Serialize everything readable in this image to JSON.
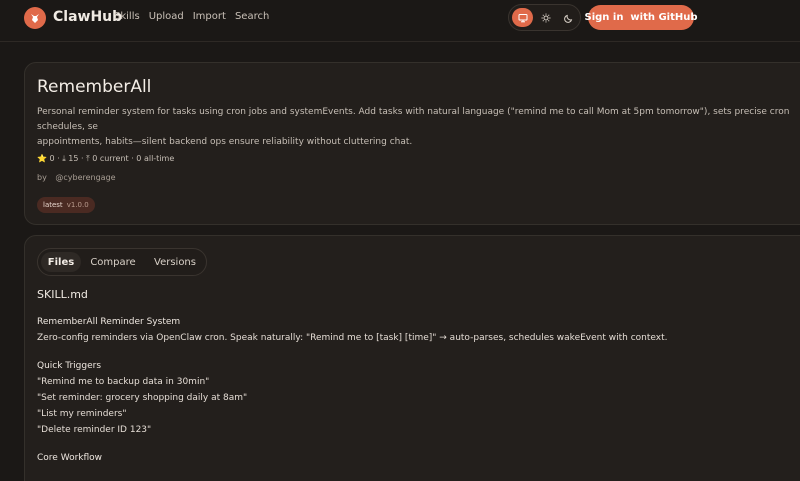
{
  "header": {
    "brand": "ClawHub",
    "nav": [
      "Skills",
      "Upload",
      "Import",
      "Search"
    ],
    "theme_icons": [
      "monitor-icon",
      "sun-icon",
      "moon-icon"
    ],
    "sign_in": "Sign in  with GitHub",
    "accent": "#e06a4a"
  },
  "skill": {
    "title": "RememberAll",
    "description_line1": "Personal reminder system for tasks using cron jobs and systemEvents. Add tasks with natural language (\"remind me to call Mom at 5pm tomorrow\"), sets precise cron schedules, se",
    "description_line2": "appointments, habits—silent backend ops ensure reliability without cluttering chat.",
    "stats": "⭐ 0 · ⤓ 15 · ⤒ 0 current · 0 all-time",
    "by_label": "by",
    "author": "@cyberengage",
    "tag_label": "latest",
    "tag_version": "v1.0.0"
  },
  "files": {
    "tabs": [
      "Files",
      "Compare",
      "Versions"
    ],
    "active_tab": "Files",
    "file_name": "SKILL.md",
    "lines": [
      "RememberAll Reminder System",
      "Zero-config reminders via OpenClaw cron. Speak naturally: \"Remind me to [task] [time]\" → auto-parses, schedules wakeEvent with context.",
      "Quick Triggers",
      "\"Remind me to backup data in 30min\"",
      "\"Set reminder: grocery shopping daily at 8am\"",
      "\"List my reminders\"",
      "\"Delete reminder ID 123\"",
      "Core Workflow"
    ]
  }
}
